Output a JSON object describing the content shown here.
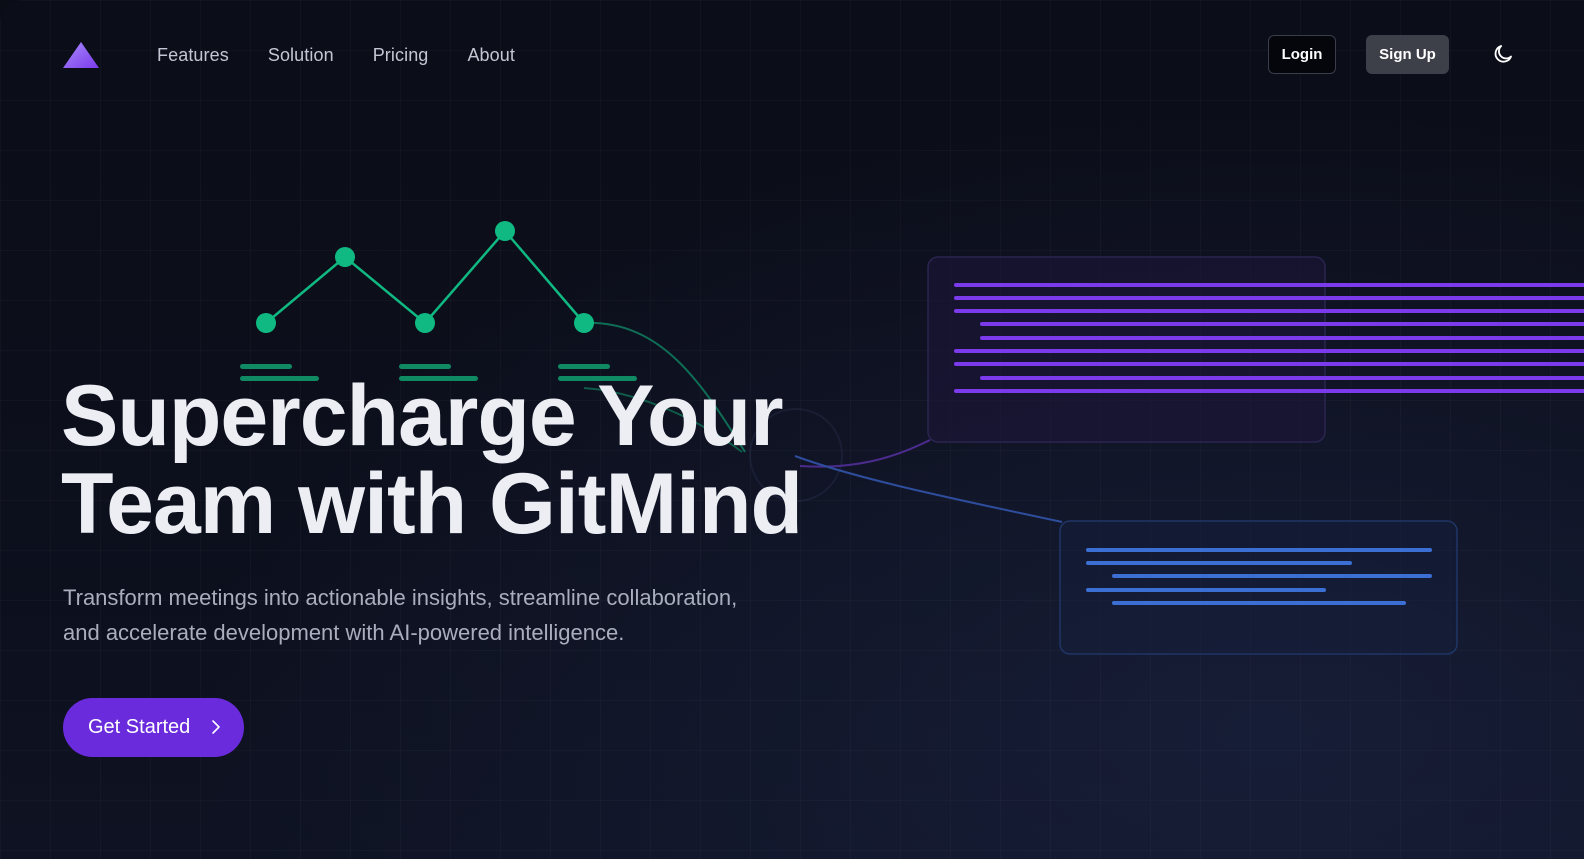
{
  "nav": {
    "logo_name": "triangle-logo",
    "links": [
      {
        "label": "Features"
      },
      {
        "label": "Solution"
      },
      {
        "label": "Pricing"
      },
      {
        "label": "About"
      }
    ],
    "login_label": "Login",
    "signup_label": "Sign Up",
    "theme_icon": "moon-icon"
  },
  "hero": {
    "title_line1": "Supercharge Your",
    "title_line2": "Team with GitMind",
    "subtitle_line1": "Transform meetings into actionable insights, streamline collaboration,",
    "subtitle_line2": "and accelerate development with AI-powered intelligence.",
    "cta_label": "Get Started",
    "cta_icon": "chevron-right-icon"
  },
  "colors": {
    "accent_purple": "#6a2bdc",
    "graph_green": "#10b981",
    "code_purple": "#7c3aed",
    "code_blue": "#3b6fd4",
    "background": "#0b0d18"
  }
}
